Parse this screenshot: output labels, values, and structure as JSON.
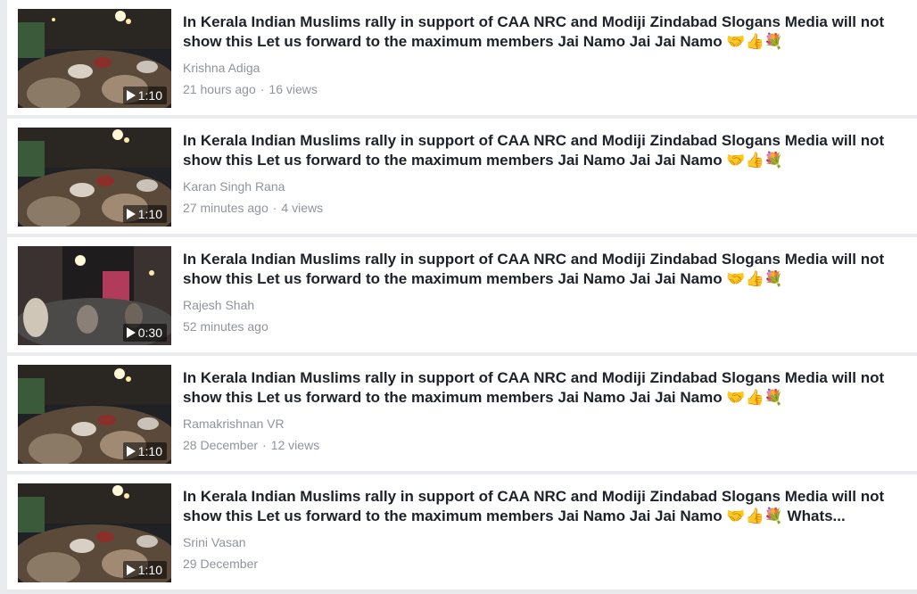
{
  "videos": [
    {
      "title": "In Kerala Indian Muslims rally in support of CAA NRC and Modiji Zindabad Slogans Media will not show this Let us forward to the maximum members Jai Namo Jai Jai Namo 🤝👍💐",
      "author": "Krishna Adiga",
      "time": "21 hours ago",
      "separator": "·",
      "views": "16 views",
      "duration": "1:10"
    },
    {
      "title": "In Kerala Indian Muslims rally in support of CAA NRC and Modiji Zindabad Slogans Media will not show this Let us forward to the maximum members Jai Namo Jai Jai Namo 🤝👍💐",
      "author": "Karan Singh Rana",
      "time": "27 minutes ago",
      "separator": "·",
      "views": "4 views",
      "duration": "1:10"
    },
    {
      "title": "In Kerala Indian Muslims rally in support of CAA NRC and Modiji Zindabad Slogans Media will not show this Let us forward to the maximum members Jai Namo Jai Jai Namo 🤝👍💐",
      "author": "Rajesh Shah",
      "time": "52 minutes ago",
      "duration": "0:30"
    },
    {
      "title": "In Kerala Indian Muslims rally in support of CAA NRC and Modiji Zindabad Slogans Media will not show this Let us forward to the maximum members Jai Namo Jai Jai Namo 🤝👍💐",
      "author": "Ramakrishnan VR",
      "time": "28 December",
      "separator": "·",
      "views": "12 views",
      "duration": "1:10"
    },
    {
      "title": "In Kerala Indian Muslims rally in support of CAA NRC and Modiji Zindabad Slogans Media will not show this Let us forward to the maximum members Jai Namo Jai Jai Namo 🤝👍💐 Whats...",
      "author": "Srini Vasan",
      "time": "29 December",
      "duration": "1:10"
    }
  ]
}
